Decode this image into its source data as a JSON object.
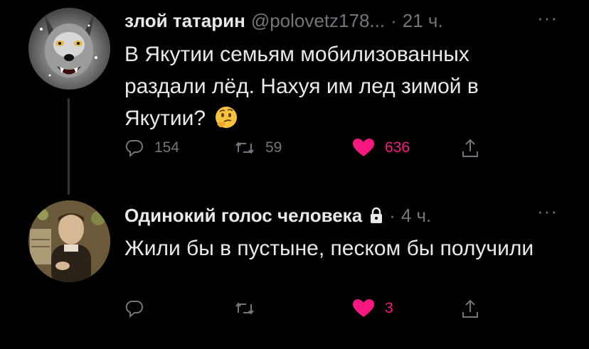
{
  "tweets": [
    {
      "author_name": "злой татарин",
      "handle": "@polovetz178...",
      "separator": "·",
      "time": "21 ч.",
      "more": "···",
      "text": "В Якутии семьям мобилизованных раздали лёд. Нахуя им лед зимой в Якутии?",
      "emoji": "thinking-face-icon",
      "replies": "154",
      "retweets": "59",
      "likes": "636",
      "liked": true,
      "avatar": "wolf-avatar"
    },
    {
      "author_name": "Одинокий голос человека",
      "locked": true,
      "separator": "·",
      "time": "4 ч.",
      "more": "···",
      "text": "Жили бы в пустыне, песком бы получили",
      "replies": "",
      "retweets": "",
      "likes": "3",
      "liked": true,
      "avatar": "monk-portrait-avatar"
    }
  ],
  "colors": {
    "background": "#000000",
    "text": "#e7e9ea",
    "muted": "#71767b",
    "like": "#f91880",
    "thread_line": "#333639"
  }
}
